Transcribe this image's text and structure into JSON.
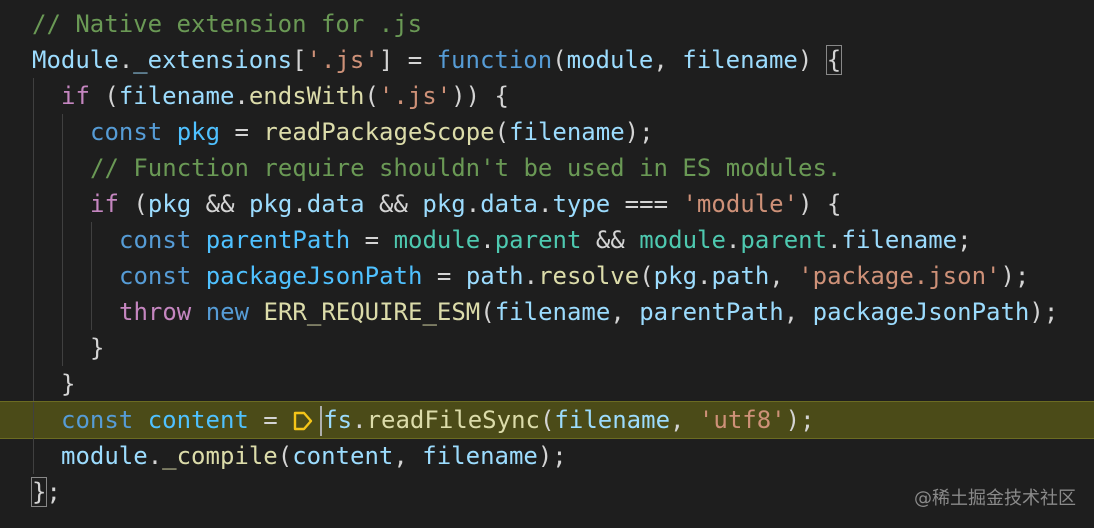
{
  "editor": {
    "lines": [
      {
        "tokens": [
          [
            "tk-cm",
            "// Native extension for .js"
          ]
        ]
      },
      {
        "tokens": [
          [
            "tk-var",
            "Module"
          ],
          [
            "tk-op",
            "."
          ],
          [
            "tk-var",
            "_extensions"
          ],
          [
            "tk-op",
            "["
          ],
          [
            "tk-str",
            "'.js'"
          ],
          [
            "tk-op",
            "] = "
          ],
          [
            "tk-kw",
            "function"
          ],
          [
            "tk-op",
            "("
          ],
          [
            "tk-var",
            "module"
          ],
          [
            "tk-op",
            ", "
          ],
          [
            "tk-var",
            "filename"
          ],
          [
            "tk-op",
            ") "
          ],
          [
            "brace",
            "{"
          ]
        ]
      },
      {
        "tokens": [
          [
            "tk-ctl",
            "if"
          ],
          [
            "tk-op",
            " ("
          ],
          [
            "tk-var",
            "filename"
          ],
          [
            "tk-op",
            "."
          ],
          [
            "tk-fn",
            "endsWith"
          ],
          [
            "tk-op",
            "("
          ],
          [
            "tk-str",
            "'.js'"
          ],
          [
            "tk-op",
            ")) {"
          ]
        ]
      },
      {
        "tokens": [
          [
            "tk-kw",
            "const"
          ],
          [
            "tk-op",
            " "
          ],
          [
            "tk-cst",
            "pkg"
          ],
          [
            "tk-op",
            " = "
          ],
          [
            "tk-fn",
            "readPackageScope"
          ],
          [
            "tk-op",
            "("
          ],
          [
            "tk-var",
            "filename"
          ],
          [
            "tk-op",
            ");"
          ]
        ]
      },
      {
        "tokens": [
          [
            "tk-cm",
            "// Function require shouldn't be used in ES modules."
          ]
        ]
      },
      {
        "tokens": [
          [
            "tk-ctl",
            "if"
          ],
          [
            "tk-op",
            " ("
          ],
          [
            "tk-var",
            "pkg"
          ],
          [
            "tk-op",
            " && "
          ],
          [
            "tk-var",
            "pkg"
          ],
          [
            "tk-op",
            "."
          ],
          [
            "tk-var",
            "data"
          ],
          [
            "tk-op",
            " && "
          ],
          [
            "tk-var",
            "pkg"
          ],
          [
            "tk-op",
            "."
          ],
          [
            "tk-var",
            "data"
          ],
          [
            "tk-op",
            "."
          ],
          [
            "tk-var",
            "type"
          ],
          [
            "tk-op",
            " === "
          ],
          [
            "tk-str",
            "'module'"
          ],
          [
            "tk-op",
            ") {"
          ]
        ]
      },
      {
        "tokens": [
          [
            "tk-kw",
            "const"
          ],
          [
            "tk-op",
            " "
          ],
          [
            "tk-cst",
            "parentPath"
          ],
          [
            "tk-op",
            " = "
          ],
          [
            "tk-type",
            "module"
          ],
          [
            "tk-op",
            "."
          ],
          [
            "tk-type",
            "parent"
          ],
          [
            "tk-op",
            " && "
          ],
          [
            "tk-type",
            "module"
          ],
          [
            "tk-op",
            "."
          ],
          [
            "tk-type",
            "parent"
          ],
          [
            "tk-op",
            "."
          ],
          [
            "tk-var",
            "filename"
          ],
          [
            "tk-op",
            ";"
          ]
        ]
      },
      {
        "tokens": [
          [
            "tk-kw",
            "const"
          ],
          [
            "tk-op",
            " "
          ],
          [
            "tk-cst",
            "packageJsonPath"
          ],
          [
            "tk-op",
            " = "
          ],
          [
            "tk-var",
            "path"
          ],
          [
            "tk-op",
            "."
          ],
          [
            "tk-fn",
            "resolve"
          ],
          [
            "tk-op",
            "("
          ],
          [
            "tk-var",
            "pkg"
          ],
          [
            "tk-op",
            "."
          ],
          [
            "tk-var",
            "path"
          ],
          [
            "tk-op",
            ", "
          ],
          [
            "tk-str",
            "'package.json'"
          ],
          [
            "tk-op",
            ");"
          ]
        ]
      },
      {
        "tokens": [
          [
            "tk-ctl",
            "throw"
          ],
          [
            "tk-op",
            " "
          ],
          [
            "tk-kw",
            "new"
          ],
          [
            "tk-op",
            " "
          ],
          [
            "tk-fn",
            "ERR_REQUIRE_ESM"
          ],
          [
            "tk-op",
            "("
          ],
          [
            "tk-var",
            "filename"
          ],
          [
            "tk-op",
            ", "
          ],
          [
            "tk-var",
            "parentPath"
          ],
          [
            "tk-op",
            ", "
          ],
          [
            "tk-var",
            "packageJsonPath"
          ],
          [
            "tk-op",
            ");"
          ]
        ]
      },
      {
        "tokens": [
          [
            "tk-op",
            "}"
          ]
        ]
      },
      {
        "tokens": [
          [
            "tk-op",
            "}"
          ]
        ]
      },
      {
        "tokens": [
          [
            "tk-kw",
            "const"
          ],
          [
            "tk-op",
            " "
          ],
          [
            "tk-cst",
            "content"
          ],
          [
            "tk-op",
            " = "
          ],
          [
            "bp",
            ""
          ],
          [
            "cursor",
            ""
          ],
          [
            "tk-var",
            "fs"
          ],
          [
            "tk-op",
            "."
          ],
          [
            "tk-fn",
            "readFileSync"
          ],
          [
            "tk-op",
            "("
          ],
          [
            "tk-var",
            "filename"
          ],
          [
            "tk-op",
            ", "
          ],
          [
            "tk-str",
            "'utf8'"
          ],
          [
            "tk-op",
            ");"
          ]
        ]
      },
      {
        "tokens": [
          [
            "tk-var",
            "module"
          ],
          [
            "tk-op",
            "."
          ],
          [
            "tk-fn",
            "_compile"
          ],
          [
            "tk-op",
            "("
          ],
          [
            "tk-var",
            "content"
          ],
          [
            "tk-op",
            ", "
          ],
          [
            "tk-var",
            "filename"
          ],
          [
            "tk-op",
            ");"
          ]
        ]
      },
      {
        "tokens": [
          [
            "brace",
            "}"
          ],
          [
            "tk-op",
            ";"
          ]
        ]
      }
    ]
  },
  "watermark": {
    "text": "@稀土掘金技术社区"
  },
  "colors": {
    "background": "#1e1e1e",
    "current_line": "#4b4b18",
    "comment": "#6a9955",
    "keyword": "#569cd6",
    "control": "#c586c0",
    "function": "#dcdcaa",
    "variable": "#9cdcfe",
    "string": "#ce9178",
    "breakpoint_icon": "#f5c518"
  },
  "icons": {
    "debug_stop": "execution-point-icon"
  }
}
